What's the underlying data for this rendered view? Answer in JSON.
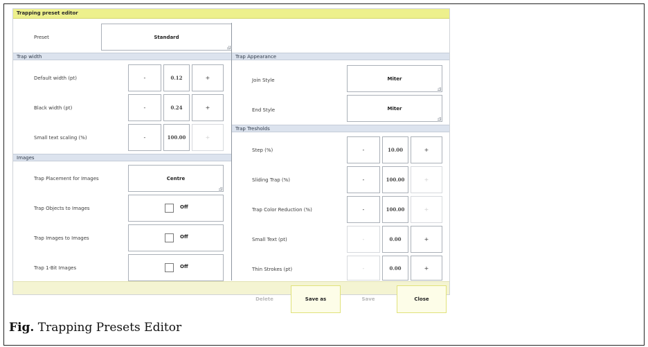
{
  "window": {
    "title": "Trapping preset editor"
  },
  "preset": {
    "label": "Preset",
    "value": "Standard"
  },
  "trap_width": {
    "header": "Trap width",
    "rows": [
      {
        "label": "Default width (pt)",
        "minus": "-",
        "value": "0.12",
        "plus": "+"
      },
      {
        "label": "Black width (pt)",
        "minus": "-",
        "value": "0.24",
        "plus": "+"
      },
      {
        "label": "Small text scaling (%)",
        "minus": "-",
        "value": "100.00",
        "plus": "+"
      }
    ]
  },
  "images": {
    "header": "Images",
    "placement": {
      "label": "Trap Placement for Images",
      "value": "Centre"
    },
    "toggles": [
      {
        "label": "Trap Objects to Images",
        "state": "Off"
      },
      {
        "label": "Trap Images to Images",
        "state": "Off"
      },
      {
        "label": "Trap 1-Bit Images",
        "state": "Off"
      }
    ]
  },
  "trap_appearance": {
    "header": "Trap Appearance",
    "join_style": {
      "label": "Join Style",
      "value": "Miter"
    },
    "end_style": {
      "label": "End Style",
      "value": "Miter"
    }
  },
  "trap_thresholds": {
    "header": "Trap Tresholds",
    "rows": [
      {
        "label": "Step (%)",
        "minus": "-",
        "value": "10.00",
        "plus": "+"
      },
      {
        "label": "Sliding Trap (%)",
        "minus": "-",
        "value": "100.00",
        "plus": "+"
      },
      {
        "label": "Trap Color Reduction (%)",
        "minus": "-",
        "value": "100.00",
        "plus": "+"
      },
      {
        "label": "Small Text (pt)",
        "minus": "-",
        "value": "0.00",
        "plus": "+"
      },
      {
        "label": "Thin Strokes (pt)",
        "minus": "-",
        "value": "0.00",
        "plus": "+"
      }
    ]
  },
  "footer": {
    "delete": "Delete",
    "save_as": "Save as",
    "save": "Save",
    "close": "Close"
  },
  "caption": {
    "prefix": "Fig.",
    "text": " Trapping Presets Editor"
  }
}
